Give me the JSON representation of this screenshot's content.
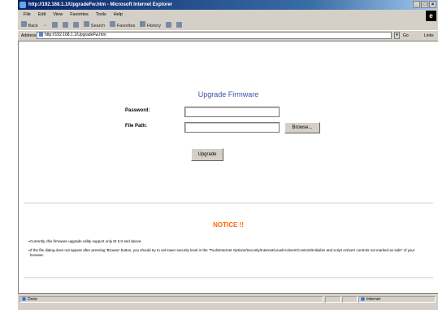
{
  "window": {
    "title": "http://192.168.1.1/UpgradeFw.htm - Microsoft Internet Explorer",
    "controls": [
      "_",
      "□",
      "×"
    ]
  },
  "menu": [
    "File",
    "Edit",
    "View",
    "Favorites",
    "Tools",
    "Help"
  ],
  "toolbar": {
    "back": "Back",
    "forward": "→",
    "search": "Search",
    "favorites": "Favorites",
    "history": "History"
  },
  "address": {
    "label": "Address",
    "url": "http://192.168.1.1/UpgradeFw.htm",
    "go": "Go",
    "links": "Links"
  },
  "page": {
    "title": "Upgrade Firmware",
    "password_label": "Password:",
    "password_value": "",
    "filepath_label": "File Path:",
    "filepath_value": "",
    "browse_label": "Browse...",
    "upgrade_label": "Upgrade",
    "notice_title": "NOTICE !!",
    "notices": [
      "Currently, this firmware upgrade utility support only IE 5.0 and above.",
      "If the file dialog does not appear after pressing 'Browse' button, you should try to set lower security level in the \"Tools/Internet Options/Security/Internet/Level/ActiveX/Controls/Initialize and script ActiveX controls not marked as safe\" of your browser."
    ]
  },
  "status": {
    "text": "Done",
    "zone": "Internet"
  }
}
